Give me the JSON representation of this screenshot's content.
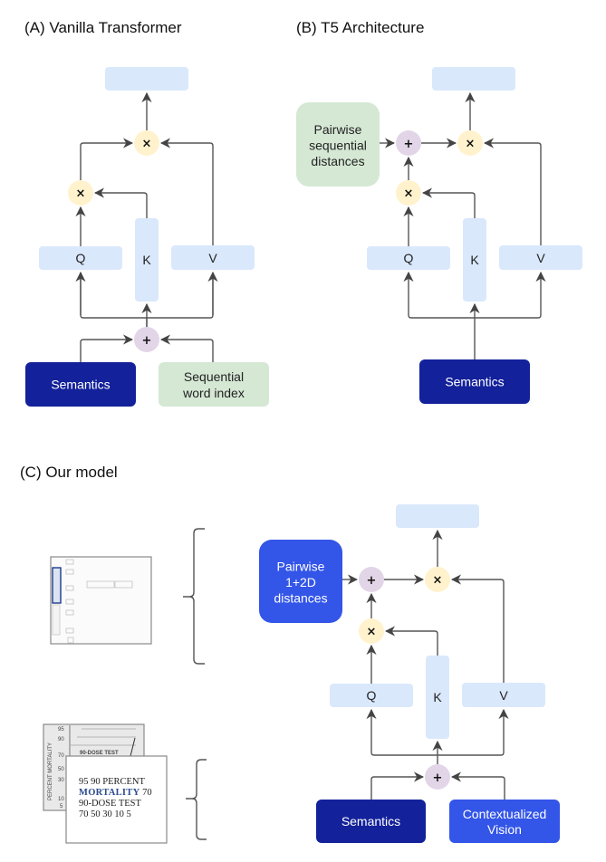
{
  "panels": {
    "a": {
      "title": "(A) Vanilla Transformer",
      "q": "Q",
      "k": "K",
      "v": "V",
      "mult": "×",
      "plus": "+",
      "inputs": {
        "left": "Semantics",
        "right_line1": "Sequential",
        "right_line2": "word index"
      }
    },
    "b": {
      "title": "(B) T5 Architecture",
      "q": "Q",
      "k": "K",
      "v": "V",
      "mult": "×",
      "plus": "+",
      "bias_line1": "Pairwise",
      "bias_line2": "sequential",
      "bias_line3": "distances",
      "inputs": {
        "center": "Semantics"
      }
    },
    "c": {
      "title": "(C) Our model",
      "q": "Q",
      "k": "K",
      "v": "V",
      "mult": "×",
      "plus": "+",
      "bias_line1": "Pairwise",
      "bias_line2": "1+2D",
      "bias_line3": "distances",
      "inputs": {
        "left": "Semantics",
        "right_line1": "Contextualized",
        "right_line2": "Vision"
      },
      "doc_thumbnail": {
        "back_axis_label": "PERCENT MORTALITY",
        "back_ticks": [
          "95",
          "90",
          "70",
          "50",
          "30",
          "10",
          "5"
        ],
        "back_caption": "90-DOSE TEST",
        "front_line1": "95 90 PERCENT",
        "front_line2_bold": "MORTALITY",
        "front_line2_rest": " 70",
        "front_line3": "90-DOSE TEST",
        "front_line4": "70 50 30 10 5"
      }
    }
  },
  "colors": {
    "qkv_box": "#dae8fc",
    "mult_node": "#fff2cc",
    "plus_node": "#e1d5e7",
    "green_box": "#d5e8d4",
    "semantics_dark": "#13219a",
    "blue_box": "#3355e8",
    "wire": "#555555"
  }
}
